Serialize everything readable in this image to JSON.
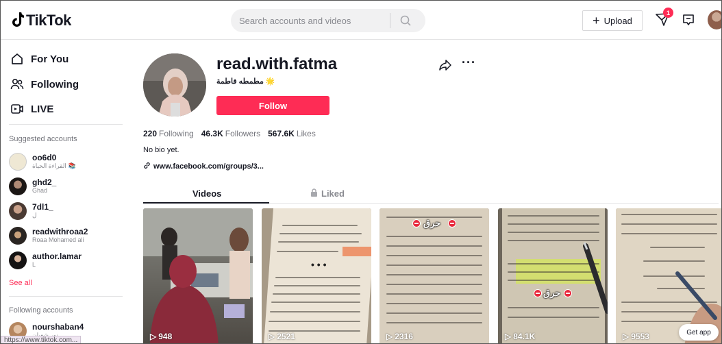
{
  "header": {
    "logo_text": "TikTok",
    "search_placeholder": "Search accounts and videos",
    "upload_label": "Upload",
    "inbox_badge": "1"
  },
  "sidebar": {
    "nav": [
      {
        "label": "For You"
      },
      {
        "label": "Following"
      },
      {
        "label": "LIVE"
      }
    ],
    "suggested_title": "Suggested accounts",
    "suggested": [
      {
        "username": "oo6d0",
        "name": "القراءة الحياة 📚"
      },
      {
        "username": "ghd2_",
        "name": "Ghad"
      },
      {
        "username": "7dl1_",
        "name": "ل"
      },
      {
        "username": "readwithroaa2",
        "name": "Roaa Mohamed ali"
      },
      {
        "username": "author.lamar",
        "name": "L"
      }
    ],
    "see_all": "See all",
    "following_title": "Following accounts",
    "following": [
      {
        "username": "nourshaban4",
        "name": "نور شعبان"
      }
    ],
    "status_url": "https://www.tiktok.com..."
  },
  "profile": {
    "username": "read.with.fatma",
    "nickname": "مطمطه فاطمة 🌟",
    "follow_label": "Follow",
    "following_count": "220",
    "following_label": "Following",
    "followers_count": "46.3K",
    "followers_label": "Followers",
    "likes_count": "567.6K",
    "likes_label": "Likes",
    "bio": "No bio yet.",
    "link": "www.facebook.com/groups/3..."
  },
  "tabs": [
    {
      "label": "Videos",
      "active": true
    },
    {
      "label": "Liked",
      "active": false
    }
  ],
  "videos": [
    {
      "views": "948"
    },
    {
      "views": "2521"
    },
    {
      "views": "2316",
      "overlay_text": "حرق"
    },
    {
      "views": "84.1K",
      "overlay_text": "حرق"
    },
    {
      "views": "9553"
    }
  ],
  "get_app": "Get app",
  "colors": {
    "accent": "#fe2c55",
    "text": "#161823",
    "muted": "#73747b"
  }
}
